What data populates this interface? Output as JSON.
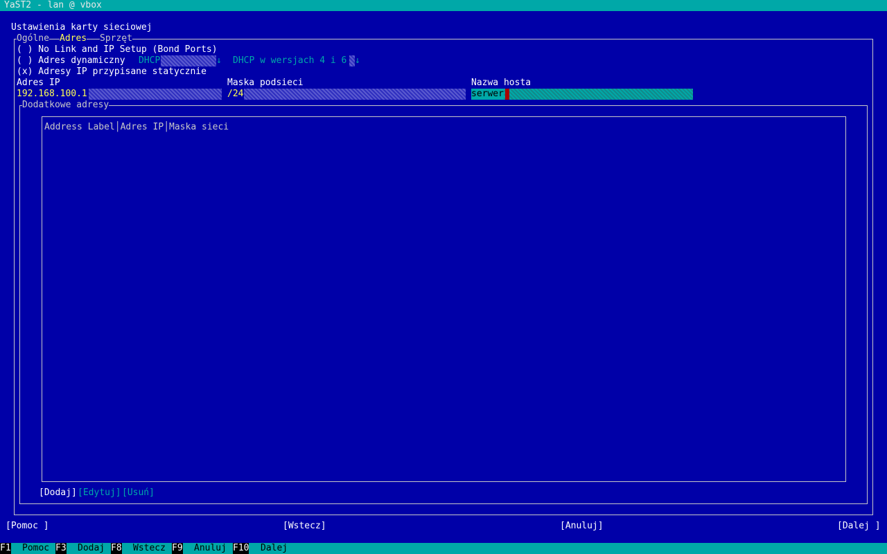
{
  "window": {
    "title": "YaST2 - lan @ vbox"
  },
  "dialog": {
    "title": "Ustawienia karty sieciowej",
    "tabs": [
      "Ogólne",
      "Adres",
      "Sprzęt"
    ],
    "options": {
      "no_link": "( ) No Link and IP Setup (Bond Ports)",
      "dynamic": "( ) Adres dynamiczny",
      "dhcp_value": "DHCP",
      "dhcp_version": "DHCP w wersjach 4 i 6",
      "static": "(x) Adresy IP przypisane statycznie"
    },
    "fields": {
      "ip_label": "Adres IP",
      "ip_value": "192.168.100.1",
      "mask_label": "Maska podsieci",
      "mask_value": "/24",
      "host_label": "Nazwa hosta",
      "host_value": "serwer"
    },
    "additional": {
      "title": "Dodatkowe adresy",
      "columns": [
        "Address Label",
        "Adres IP",
        "Maska sieci"
      ],
      "buttons": [
        "[Dodaj]",
        "[Edytuj]",
        "[Usuń]"
      ]
    }
  },
  "buttons": {
    "help": "[Pomoc ]",
    "back": "[Wstecz]",
    "cancel": "[Anuluj]",
    "next": "[Dalej ]"
  },
  "fkeys": [
    {
      "key": "F1",
      "label": "Pomoc"
    },
    {
      "key": "F3",
      "label": "Dodaj"
    },
    {
      "key": "F8",
      "label": "Wstecz"
    },
    {
      "key": "F9",
      "label": "Anuluj"
    },
    {
      "key": "F10",
      "label": "Dalej"
    }
  ],
  "colors": {
    "background": "#0000a8",
    "bar": "#00a8a8",
    "highlight": "#ffff54",
    "text": "#c8c8c8"
  }
}
